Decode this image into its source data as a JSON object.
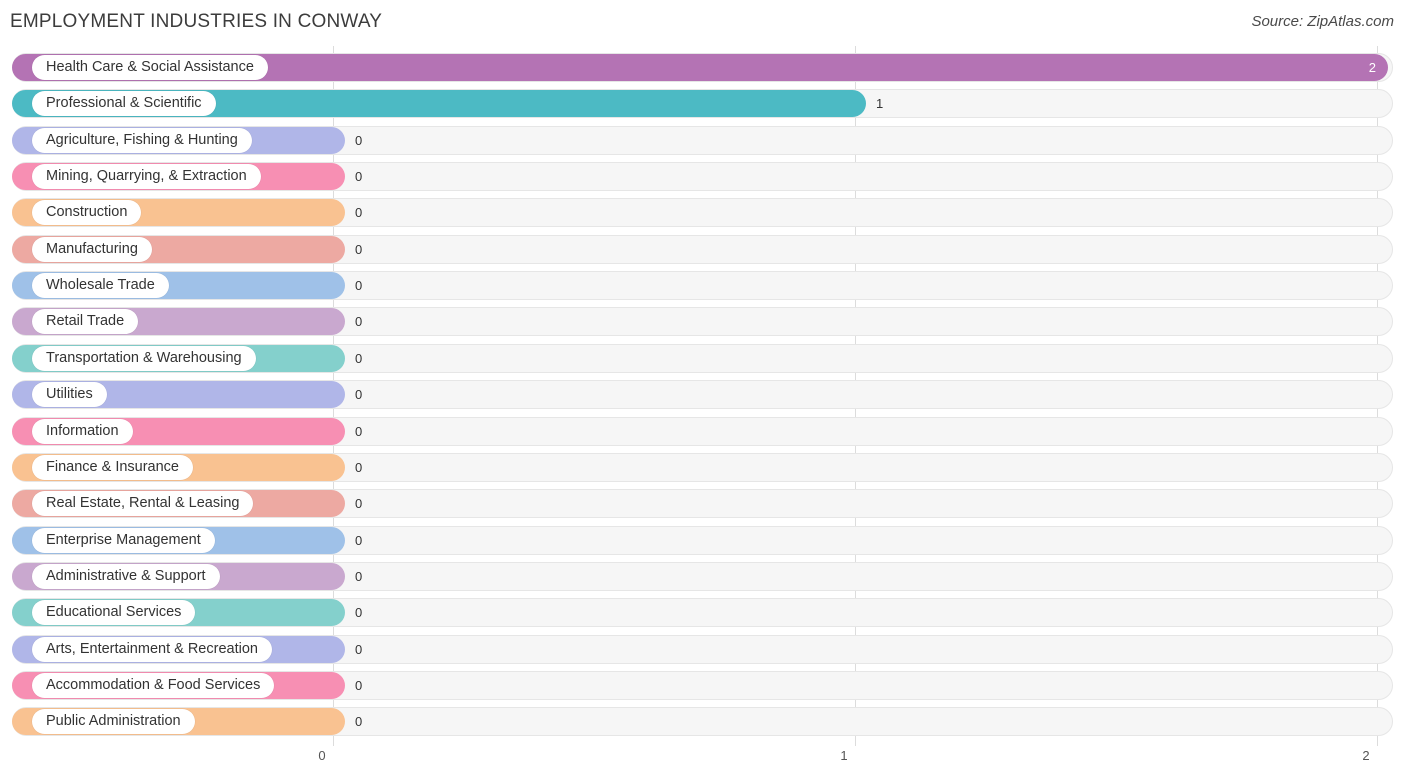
{
  "header": {
    "title": "EMPLOYMENT INDUSTRIES IN CONWAY",
    "source": "Source: ZipAtlas.com"
  },
  "chart_data": {
    "type": "bar",
    "orientation": "horizontal",
    "title": "EMPLOYMENT INDUSTRIES IN CONWAY",
    "xlabel": "",
    "ylabel": "",
    "xlim": [
      0,
      2
    ],
    "grid": true,
    "legend": "none",
    "ticks": [
      "0",
      "1",
      "2"
    ],
    "tick_values": [
      0,
      1,
      2
    ],
    "categories": [
      "Health Care & Social Assistance",
      "Professional & Scientific",
      "Agriculture, Fishing & Hunting",
      "Mining, Quarrying, & Extraction",
      "Construction",
      "Manufacturing",
      "Wholesale Trade",
      "Retail Trade",
      "Transportation & Warehousing",
      "Utilities",
      "Information",
      "Finance & Insurance",
      "Real Estate, Rental & Leasing",
      "Enterprise Management",
      "Administrative & Support",
      "Educational Services",
      "Arts, Entertainment & Recreation",
      "Accommodation & Food Services",
      "Public Administration"
    ],
    "values": [
      2,
      1,
      0,
      0,
      0,
      0,
      0,
      0,
      0,
      0,
      0,
      0,
      0,
      0,
      0,
      0,
      0,
      0,
      0
    ],
    "value_labels": [
      "2",
      "1",
      "0",
      "0",
      "0",
      "0",
      "0",
      "0",
      "0",
      "0",
      "0",
      "0",
      "0",
      "0",
      "0",
      "0",
      "0",
      "0",
      "0"
    ],
    "colors": [
      "#b473b4",
      "#4cbac4",
      "#b0b6e8",
      "#f78fb3",
      "#f9c291",
      "#eda9a2",
      "#9fc1e8",
      "#c9a8cf",
      "#84d0cc",
      "#b0b6e8",
      "#f78fb3",
      "#f9c291",
      "#eda9a2",
      "#9fc1e8",
      "#c9a8cf",
      "#84d0cc",
      "#b0b6e8",
      "#f78fb3",
      "#f9c291"
    ]
  }
}
